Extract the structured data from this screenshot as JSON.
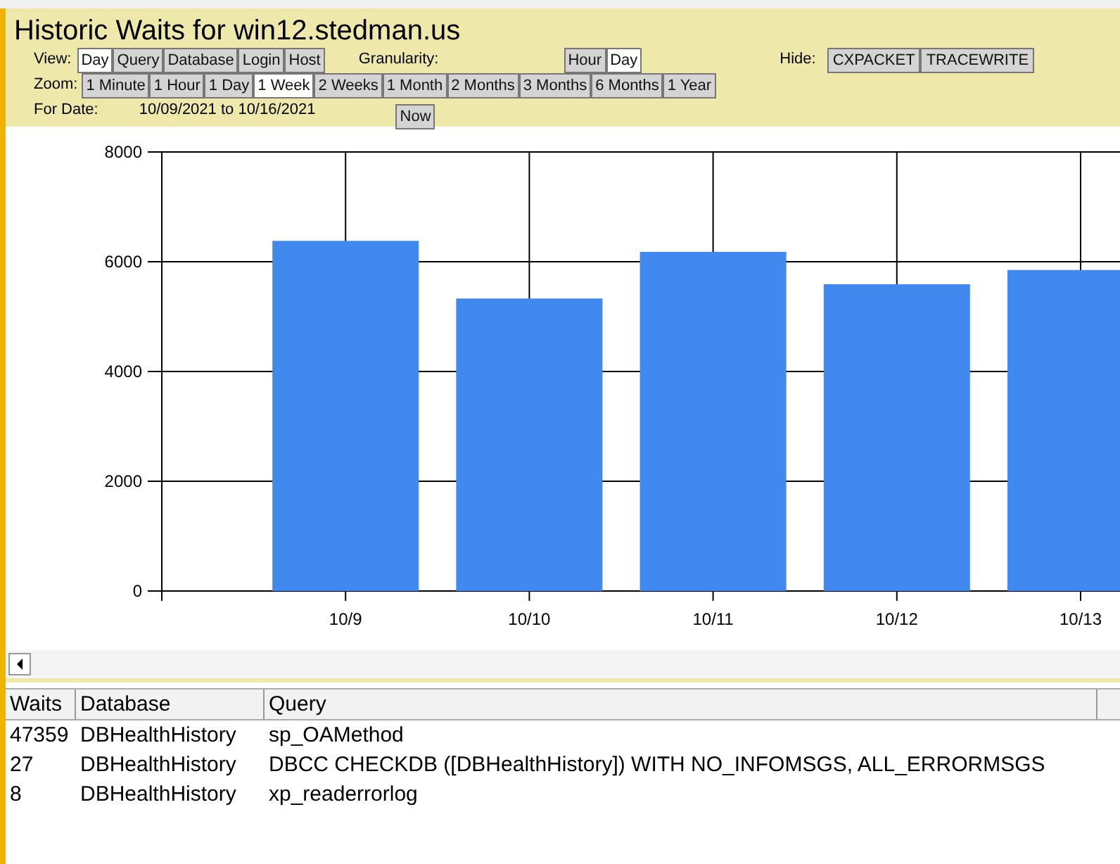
{
  "title": "Historic Waits for win12.stedman.us",
  "view": {
    "label": "View:",
    "options": [
      {
        "label": "Day",
        "selected": true
      },
      {
        "label": "Query",
        "selected": false
      },
      {
        "label": "Database",
        "selected": false
      },
      {
        "label": "Login",
        "selected": false
      },
      {
        "label": "Host",
        "selected": false
      }
    ]
  },
  "granularity": {
    "label": "Granularity:",
    "options": [
      {
        "label": "Hour",
        "selected": false
      },
      {
        "label": "Day",
        "selected": true
      }
    ]
  },
  "hide": {
    "label": "Hide:",
    "buttons": [
      "CXPACKET",
      "TRACEWRITE"
    ]
  },
  "zoom": {
    "label": "Zoom:",
    "options": [
      {
        "label": "1 Minute",
        "selected": false
      },
      {
        "label": "1 Hour",
        "selected": false
      },
      {
        "label": "1 Day",
        "selected": false
      },
      {
        "label": "1 Week",
        "selected": true
      },
      {
        "label": "2 Weeks",
        "selected": false
      },
      {
        "label": "1 Month",
        "selected": false
      },
      {
        "label": "2 Months",
        "selected": false
      },
      {
        "label": "3 Months",
        "selected": false
      },
      {
        "label": "6 Months",
        "selected": false
      },
      {
        "label": "1 Year",
        "selected": false
      }
    ]
  },
  "date": {
    "label": "For Date:",
    "value": "10/09/2021 to 10/16/2021",
    "button": "Now"
  },
  "chart_data": {
    "type": "bar",
    "categories": [
      "10/9",
      "10/10",
      "10/11",
      "10/12",
      "10/13"
    ],
    "series": [
      {
        "color": "#4189ee",
        "values": [
          6380,
          5330,
          6180,
          5590,
          5850
        ]
      }
    ],
    "ylim": [
      0,
      8000
    ],
    "grid": true,
    "yticks": [
      0,
      2000,
      4000,
      6000,
      8000
    ]
  },
  "table": {
    "columns": [
      "Waits",
      "Database",
      "Query"
    ],
    "rows": [
      [
        "47359",
        "DBHealthHistory",
        "sp_OAMethod"
      ],
      [
        "27",
        "DBHealthHistory",
        "DBCC CHECKDB ([DBHealthHistory]) WITH NO_INFOMSGS, ALL_ERRORMSGS"
      ],
      [
        "8",
        "DBHealthHistory",
        "xp_readerrorlog"
      ]
    ]
  }
}
